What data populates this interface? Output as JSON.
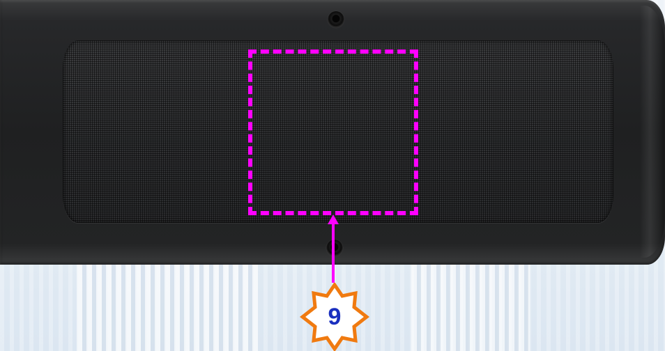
{
  "callout": {
    "number": "9",
    "highlight_color": "#ff00ff",
    "badge_border_color": "#f07a10",
    "badge_text_color": "#1a2fbf"
  },
  "device": {
    "body_color": "#202122",
    "grille_color": "#2e2f31"
  }
}
